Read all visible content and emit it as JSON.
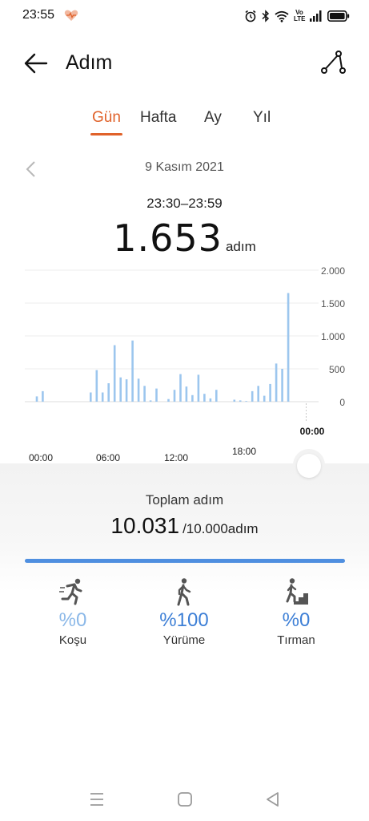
{
  "status": {
    "time": "23:55",
    "network_label": "Vo LTE"
  },
  "app": {
    "title": "Adım"
  },
  "tabs": [
    {
      "label": "Gün",
      "active": true
    },
    {
      "label": "Hafta",
      "active": false
    },
    {
      "label": "Ay",
      "active": false
    },
    {
      "label": "Yıl",
      "active": false
    }
  ],
  "date": "9 Kasım 2021",
  "selected": {
    "time_range": "23:30–23:59",
    "value": "1.653",
    "unit": "adım"
  },
  "chart_data": {
    "type": "bar",
    "x_tick_labels": [
      "00:00",
      "06:00",
      "12:00",
      "18:00"
    ],
    "selected_tick_label": "00:00",
    "y_tick_labels": [
      "2.000",
      "1.500",
      "1.000",
      "500",
      "0"
    ],
    "ylim": [
      0,
      2000
    ],
    "grid": true,
    "bar_color": "#9cc6ee",
    "highlight_color": "#2f7fd6",
    "x": [
      1,
      1.5,
      5.5,
      6,
      6.5,
      7,
      7.5,
      8,
      8.5,
      9,
      9.5,
      10,
      10.5,
      11,
      12,
      12.5,
      13,
      13.5,
      14,
      14.5,
      15,
      15.5,
      16,
      17.5,
      18,
      18.5,
      19,
      19.5,
      20,
      20.5,
      21,
      21.5,
      22,
      22.5,
      23,
      23.5
    ],
    "values": [
      80,
      160,
      140,
      480,
      140,
      280,
      860,
      370,
      340,
      930,
      350,
      240,
      20,
      200,
      40,
      180,
      420,
      230,
      100,
      410,
      120,
      50,
      180,
      30,
      20,
      10,
      160,
      240,
      90,
      270,
      580,
      500,
      1653
    ],
    "highlight_x": 23.5
  },
  "summary": {
    "label": "Toplam adım",
    "total": "10.031",
    "goal": "/10.000adım",
    "progress": 1.0
  },
  "activities": [
    {
      "label": "Koşu",
      "percent": "%0",
      "icon": "running-icon",
      "color": "#8bb8e8"
    },
    {
      "label": "Yürüme",
      "percent": "%100",
      "icon": "walking-icon",
      "color": "#3d7fd6"
    },
    {
      "label": "Tırman",
      "percent": "%0",
      "icon": "climbing-icon",
      "color": "#3d7fd6"
    }
  ],
  "colors": {
    "accent": "#e0622a",
    "progress": "#4f8fe0"
  }
}
